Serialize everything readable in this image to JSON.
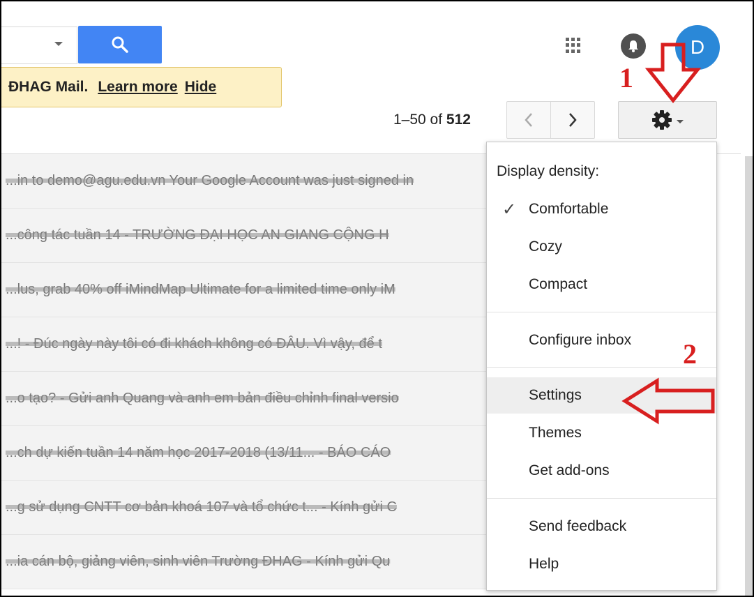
{
  "search": {
    "button_icon": "search-icon",
    "dropdown_icon": "caret-down-icon"
  },
  "topbar": {
    "apps_icon": "apps-grid-icon",
    "notifications_icon": "bell-icon",
    "avatar_letter": "D"
  },
  "banner": {
    "text": "ĐHAG Mail.",
    "learn_more": "Learn more",
    "hide": "Hide"
  },
  "pagination": {
    "range": "1–50 of ",
    "total": "512",
    "prev": "‹",
    "next": "›"
  },
  "settings": {
    "icon": "gear-icon"
  },
  "emails": [
    {
      "snippet": "...in to demo@agu.edu.vn Your Google Account was just signed in"
    },
    {
      "snippet": "...công tác tuần 14 - TRƯỜNG ĐẠI HỌC AN GIANG CỘNG H"
    },
    {
      "snippet": "...lus, grab 40% off iMindMap Ultimate for a limited time only iM"
    },
    {
      "snippet": "...! - Đúc ngày này tôi có đi khách không có ĐÂU. Vì vậy, để t"
    },
    {
      "snippet": "...o tạo? - Gửi anh Quang và anh em bản điều chỉnh final versio"
    },
    {
      "snippet": "...ch dự kiến tuần 14 năm học 2017-2018 (13/11... - BÁO CÁO"
    },
    {
      "snippet": "...g sử dụng CNTT cơ bản khoá 107 và tổ chức t... - Kính gửi C"
    },
    {
      "snippet": "...ia cán bộ, giảng viên, sinh viên Trường ĐHAG - Kính gửi Qu"
    }
  ],
  "menu": {
    "heading": "Display density:",
    "density_options": [
      "Comfortable",
      "Cozy",
      "Compact"
    ],
    "selected_density": "Comfortable",
    "configure_inbox": "Configure inbox",
    "settings": "Settings",
    "themes": "Themes",
    "get_addons": "Get add-ons",
    "send_feedback": "Send feedback",
    "help": "Help"
  },
  "annotations": {
    "step1": "1",
    "step2": "2",
    "color": "#d81f1f"
  }
}
